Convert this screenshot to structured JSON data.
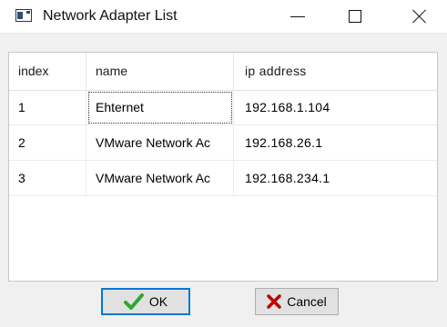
{
  "window": {
    "title": "Network Adapter List",
    "icon": "window-app-icon",
    "controls": [
      "minimize-icon",
      "maximize-icon",
      "close-icon"
    ]
  },
  "table": {
    "columns": [
      "index",
      "name",
      "ip address"
    ],
    "rows": [
      {
        "index": "1",
        "name": "Ehternet",
        "ip": "192.168.1.104"
      },
      {
        "index": "2",
        "name": "VMware Network Ac",
        "ip": "192.168.26.1"
      },
      {
        "index": "3",
        "name": "VMware Network Ac",
        "ip": "192.168.234.1"
      }
    ],
    "focused_row": 0
  },
  "buttons": {
    "ok_label": "OK",
    "ok_icon": "green-check-icon",
    "cancel_label": "Cancel",
    "cancel_icon": "red-x-icon"
  },
  "colors": {
    "ok_focus_border": "#0078d7",
    "check_green": "#2fa52f",
    "cancel_red": "#c00000"
  }
}
